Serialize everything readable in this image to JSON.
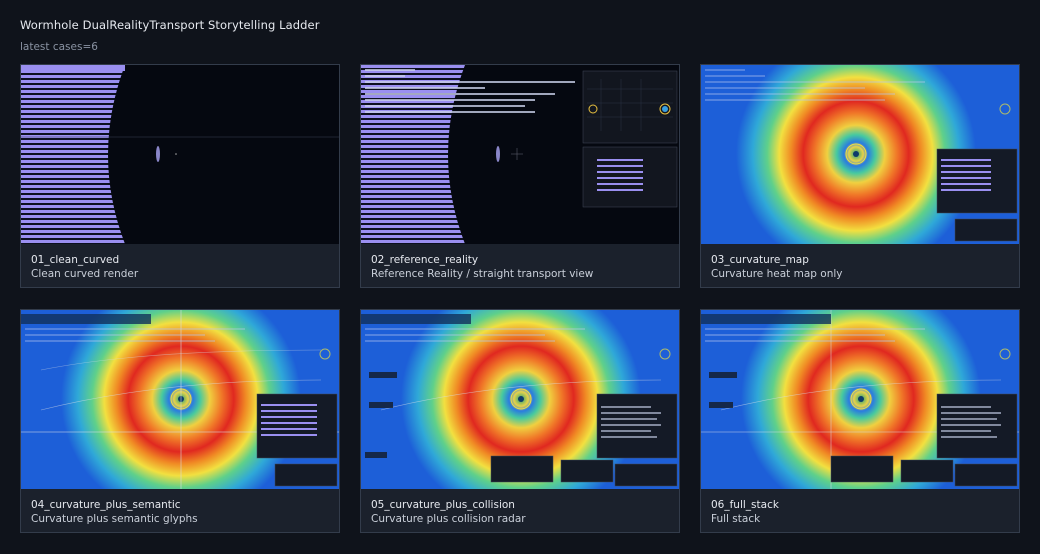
{
  "page": {
    "title": "Wormhole DualRealityTransport Storytelling Ladder",
    "subtitle": "latest cases=6"
  },
  "colors": {
    "background": "#0f131b",
    "card": "#1b212c",
    "card_border": "#333c4b",
    "heat_blue": "#1d5fd8",
    "stripe_lavender": "#9a8ff0"
  },
  "cases": [
    {
      "id": "01_clean_curved",
      "label": "Clean curved render"
    },
    {
      "id": "02_reference_reality",
      "label": "Reference Reality / straight transport view"
    },
    {
      "id": "03_curvature_map",
      "label": "Curvature heat map only"
    },
    {
      "id": "04_curvature_plus_semantic",
      "label": "Curvature plus semantic glyphs"
    },
    {
      "id": "05_curvature_plus_collision",
      "label": "Curvature plus collision radar"
    },
    {
      "id": "06_full_stack",
      "label": "Full stack"
    }
  ]
}
